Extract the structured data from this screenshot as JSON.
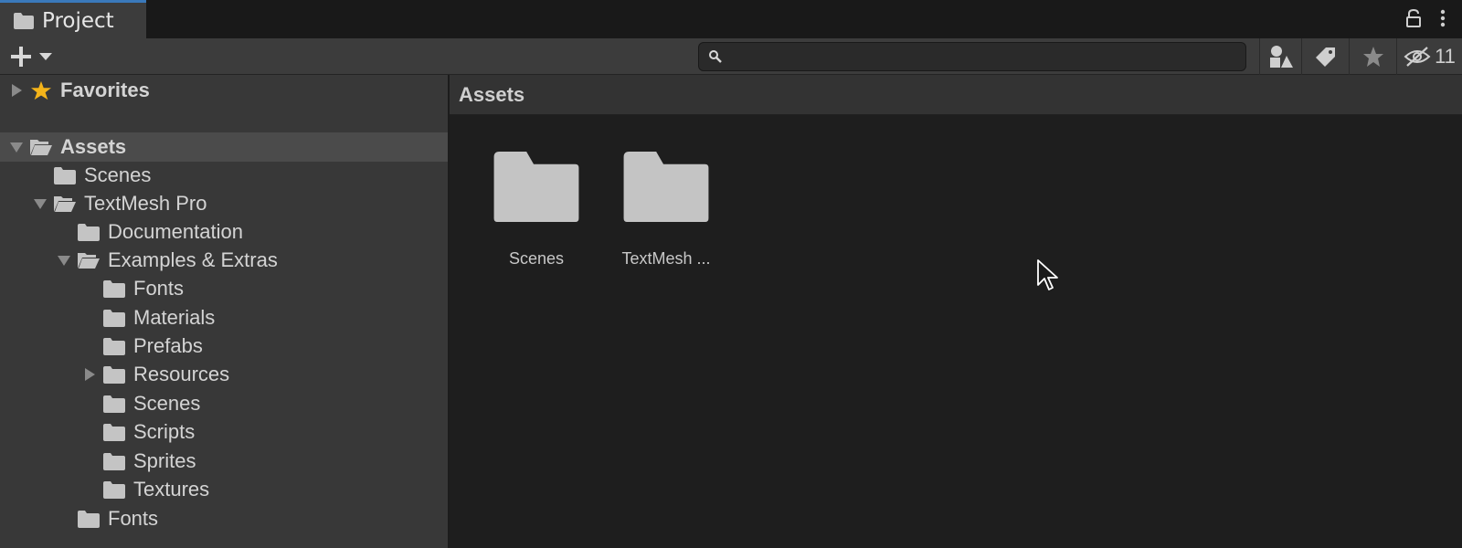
{
  "window": {
    "tab_title": "Project",
    "tab_icon": "folder-icon",
    "lock_icon": "lock-icon",
    "menu_icon": "kebab-menu-icon"
  },
  "toolbar": {
    "create_icon": "plus-icon",
    "search": {
      "value": "",
      "placeholder": ""
    },
    "hidden_count": "11"
  },
  "tree": {
    "favorites_label": "Favorites",
    "items": [
      {
        "label": "Assets",
        "depth": 0,
        "expanded": true
      },
      {
        "label": "Scenes",
        "depth": 1
      },
      {
        "label": "TextMesh Pro",
        "depth": 1,
        "expanded": true
      },
      {
        "label": "Documentation",
        "depth": 2
      },
      {
        "label": "Examples & Extras",
        "depth": 2,
        "expanded": true
      },
      {
        "label": "Fonts",
        "depth": 3
      },
      {
        "label": "Materials",
        "depth": 3
      },
      {
        "label": "Prefabs",
        "depth": 3
      },
      {
        "label": "Resources",
        "depth": 3,
        "collapsed": true
      },
      {
        "label": "Scenes",
        "depth": 3
      },
      {
        "label": "Scripts",
        "depth": 3
      },
      {
        "label": "Sprites",
        "depth": 3
      },
      {
        "label": "Textures",
        "depth": 3
      },
      {
        "label": "Fonts",
        "depth": 2
      }
    ]
  },
  "content": {
    "breadcrumb": "Assets",
    "items": [
      {
        "label": "Scenes"
      },
      {
        "label": "TextMesh ..."
      }
    ]
  },
  "colors": {
    "accent": "#3a79bb",
    "star": "#f4b41a",
    "folder": "#c4c4c4"
  }
}
